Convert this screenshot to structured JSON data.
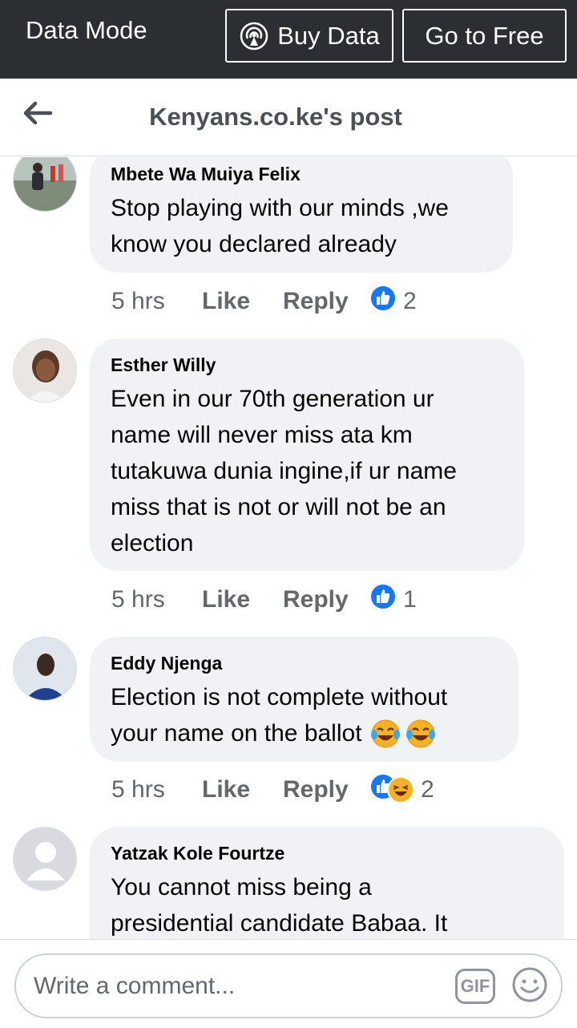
{
  "data_mode": {
    "label": "Data Mode",
    "buy_data_label": "Buy Data",
    "go_free_label": "Go to Free"
  },
  "header": {
    "title": "Kenyans.co.ke's post"
  },
  "comments": [
    {
      "author": "Mbete Wa Muiya Felix",
      "lines": [
        "Stop playing with our minds ,we",
        "know you declared already"
      ],
      "time": "5 hrs",
      "like": "Like",
      "reply": "Reply",
      "reactions": [
        "like"
      ],
      "reaction_count": "2"
    },
    {
      "author": "Esther Willy",
      "lines": [
        "Even in our 70th generation ur",
        "name will never miss ata km",
        "tutakuwa dunia ingine,if ur name",
        "miss that is not or will not be an",
        "election"
      ],
      "time": "5 hrs",
      "like": "Like",
      "reply": "Reply",
      "reactions": [
        "like"
      ],
      "reaction_count": "1"
    },
    {
      "author": "Eddy Njenga",
      "lines": [
        "Election is not complete without",
        "your name on the ballot"
      ],
      "emoji": [
        "tears-of-joy",
        "tears-of-joy"
      ],
      "time": "5 hrs",
      "like": "Like",
      "reply": "Reply",
      "reactions": [
        "like",
        "haha"
      ],
      "reaction_count": "2"
    },
    {
      "author": "Yatzak Kole Fourtze",
      "lines": [
        "You cannot miss being a",
        "presidential candidate Babaa. It"
      ]
    }
  ],
  "composer": {
    "placeholder": "Write a comment...",
    "gif_label": "GIF",
    "icons": [
      "gif-icon",
      "smiley-icon"
    ]
  },
  "colors": {
    "data_bar": "#2b2e33",
    "bubble": "#f0f2f5",
    "like_blue": "#1877f2",
    "meta_gray": "#65676b"
  }
}
